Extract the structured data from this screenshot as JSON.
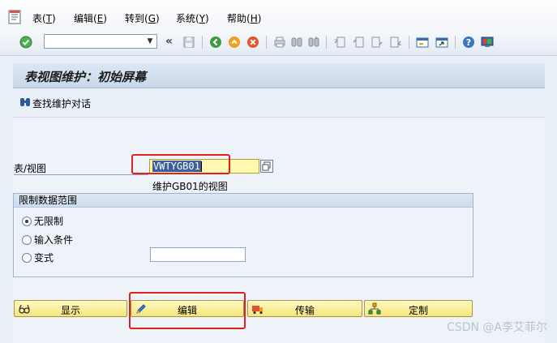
{
  "menu": {
    "items": [
      {
        "label": "表(",
        "key": "T",
        "suffix": ")"
      },
      {
        "label": "编辑(",
        "key": "E",
        "suffix": ")"
      },
      {
        "label": "转到(",
        "key": "G",
        "suffix": ")"
      },
      {
        "label": "系统(",
        "key": "Y",
        "suffix": ")"
      },
      {
        "label": "帮助(",
        "key": "H",
        "suffix": ")"
      }
    ]
  },
  "toolbar": {
    "command_value": "",
    "more_glyph": "«"
  },
  "title": "表视图维护：初始屏幕",
  "app_toolbar": {
    "find_label": "查找维护对话"
  },
  "form": {
    "table_view_label": "表/视图",
    "table_view_value": "VWTYGB01",
    "table_view_description": "维护GB01的视图"
  },
  "restrict_group": {
    "title": "限制数据范围",
    "options": [
      {
        "label": "无限制",
        "selected": true
      },
      {
        "label": "输入条件",
        "selected": false
      },
      {
        "label": "变式",
        "selected": false
      }
    ],
    "variant_value": ""
  },
  "actions": {
    "display": "显示",
    "edit": "编辑",
    "transport": "传输",
    "customize": "定制"
  },
  "colors": {
    "highlight_box": "#e0211e",
    "button_fill": "#f5e57a",
    "selection": "#3b5e9c"
  },
  "watermark": "CSDN @A李艾菲尔"
}
